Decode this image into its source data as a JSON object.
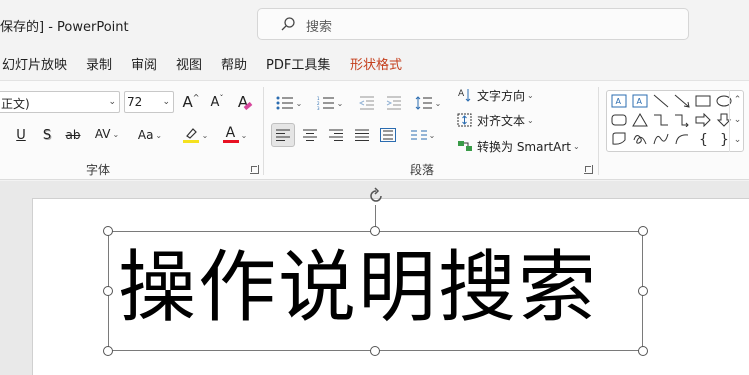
{
  "titlebar": {
    "title": "保存的] - PowerPoint"
  },
  "search": {
    "placeholder": "搜索"
  },
  "tabs": [
    {
      "label": "幻灯片放映"
    },
    {
      "label": "录制"
    },
    {
      "label": "审阅"
    },
    {
      "label": "视图"
    },
    {
      "label": "帮助"
    },
    {
      "label": "PDF工具集"
    },
    {
      "label": "形状格式"
    }
  ],
  "font_group": {
    "font_name": "正文)",
    "font_size": "72",
    "grow_label": "A",
    "shrink_label": "A",
    "clear_label": "A",
    "underline": "U",
    "shadow": "S",
    "strike": "ab",
    "spacing": "AV",
    "case": "Aa",
    "font_color": "A",
    "label": "字体",
    "highlight_color": "#f5e11f",
    "font_color_bar": "#e81123"
  },
  "paragraph_group": {
    "label": "段落",
    "text_direction": "文字方向",
    "align_text": "对齐文本",
    "smartart": "转换为 SmartArt"
  },
  "slide": {
    "text": "操作说明搜索"
  }
}
